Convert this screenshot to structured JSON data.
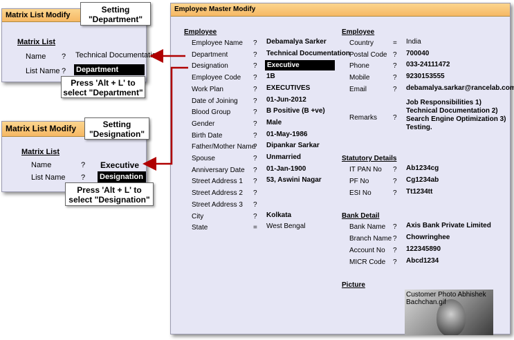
{
  "left1": {
    "title": "Matrix List Modify",
    "section": "Matrix List",
    "row1_label": "Name",
    "row1_q": "?",
    "row1_value": "Technical Documentation",
    "row2_label": "List Name",
    "row2_q": "?",
    "row2_value": "Department"
  },
  "callout1_top": {
    "line1": "Setting",
    "line2": "\"Department\""
  },
  "callout1_bottom": {
    "line1": "Press 'Alt + L' to",
    "line2": "select \"Department\""
  },
  "left2": {
    "title": "Matrix List Modify",
    "section": "Matrix List",
    "row1_label": "Name",
    "row1_q": "?",
    "row1_value": "Executive",
    "row2_label": "List Name",
    "row2_q": "?",
    "row2_value": "Designation"
  },
  "callout2_top": {
    "line1": "Setting",
    "line2": "\"Designation\""
  },
  "callout2_bottom": {
    "line1": "Press 'Alt + L' to",
    "line2": "select \"Designation\""
  },
  "main": {
    "title": "Employee Master Modify",
    "employee_heading": "Employee",
    "fields": [
      {
        "label": "Employee Name",
        "q": "?",
        "value": "Debamalya Sarker"
      },
      {
        "label": "Department",
        "q": "?",
        "value": "Technical Documentation"
      },
      {
        "label": "Designation",
        "q": "?",
        "value": "Executive"
      },
      {
        "label": "Employee Code",
        "q": "?",
        "value": "1B"
      },
      {
        "label": "Work Plan",
        "q": "?",
        "value": "EXECUTIVES"
      },
      {
        "label": "Date of Joining",
        "q": "?",
        "value": "01-Jun-2012"
      },
      {
        "label": "Blood Group",
        "q": "?",
        "value": "B Positive (B +ve)"
      },
      {
        "label": "Gender",
        "q": "?",
        "value": "Male"
      },
      {
        "label": "Birth Date",
        "q": "?",
        "value": "01-May-1986"
      },
      {
        "label": "Father/Mother Name",
        "q": "?",
        "value": "Dipankar Sarkar"
      },
      {
        "label": "Spouse",
        "q": "?",
        "value": "Unmarried"
      },
      {
        "label": "Anniversary Date",
        "q": "?",
        "value": "01-Jan-1900"
      },
      {
        "label": "Street Address 1",
        "q": "?",
        "value": "53, Aswini Nagar"
      },
      {
        "label": "Street Address 2",
        "q": "?",
        "value": ""
      },
      {
        "label": "Street Address 3",
        "q": "?",
        "value": ""
      },
      {
        "label": "City",
        "q": "?",
        "value": "Kolkata"
      },
      {
        "label": "State",
        "q": "=",
        "value": "West Bengal"
      }
    ],
    "right_heading": "Employee",
    "right_fields": [
      {
        "label": "Country",
        "q": "=",
        "value": "India"
      },
      {
        "label": "Postal Code",
        "q": "?",
        "value": "700040"
      },
      {
        "label": "Phone",
        "q": "?",
        "value": "033-24111472"
      },
      {
        "label": "Mobile",
        "q": "?",
        "value": "9230153555"
      },
      {
        "label": "Email",
        "q": "?",
        "value": "debamalya.sarkar@rancelab.com"
      }
    ],
    "remarks_label": "Remarks",
    "remarks_q": "?",
    "remarks_value": "Job Responsibilities 1) Technical Documentation 2) Search Engine Optimization 3) Testing.",
    "statutory_heading": "Statutory Details",
    "statutory": [
      {
        "label": "IT PAN No",
        "q": "?",
        "value": "Ab1234cg"
      },
      {
        "label": "PF No",
        "q": "?",
        "value": "Cg1234ab"
      },
      {
        "label": "ESI No",
        "q": "?",
        "value": "Tt1234tt"
      }
    ],
    "bank_heading": "Bank Detail",
    "bank": [
      {
        "label": "Bank Name",
        "q": "?",
        "value": "Axis Bank Private Limited"
      },
      {
        "label": "Branch Name",
        "q": "?",
        "value": "Chowringhee"
      },
      {
        "label": "Account No",
        "q": "?",
        "value": "122345890"
      },
      {
        "label": "MICR Code",
        "q": "?",
        "value": "Abcd1234"
      }
    ],
    "picture_heading": "Picture",
    "picture_caption": "Customer Photo Abhishek Bachchan.gif"
  },
  "colors": {
    "title_bar": "#f6b864",
    "panel_bg": "#e6e6f5",
    "arrow": "#b00000",
    "highlight": "#000000"
  }
}
